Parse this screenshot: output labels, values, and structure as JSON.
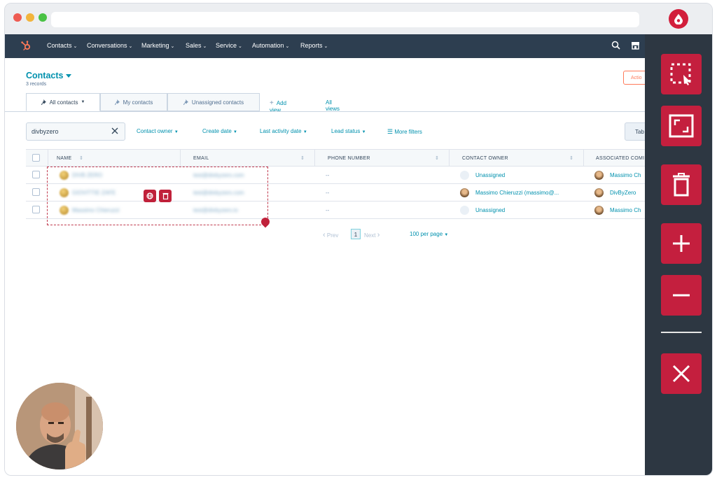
{
  "browser": {
    "extension_icon": "drop-icon"
  },
  "nav": {
    "items": [
      "Contacts",
      "Conversations",
      "Marketing",
      "Sales",
      "Service",
      "Automation",
      "Reports"
    ],
    "caret": "⌄"
  },
  "header": {
    "title": "Contacts",
    "records": "3 records",
    "actions_label": "Actio"
  },
  "tabs": {
    "items": [
      "All contacts",
      "My contacts",
      "Unassigned contacts"
    ],
    "add_view": "Add view",
    "all_views": "All views"
  },
  "filters": {
    "search_value": "divbyzero",
    "items": [
      "Contact owner",
      "Create date",
      "Last activity date",
      "Lead status"
    ],
    "more_filters": "More filters",
    "table_btn": "Tab"
  },
  "table": {
    "columns": [
      "NAME",
      "EMAIL",
      "PHONE NUMBER",
      "CONTACT OWNER",
      "ASSOCIATED COMI"
    ],
    "rows": [
      {
        "name": "DIVB ZERO",
        "email": "test@divbyzero.com",
        "phone": "--",
        "owner": "Unassigned",
        "company": "Massimo Ch"
      },
      {
        "name": "GIOVITTIE ZAFE",
        "email": "test@divbyzero.com",
        "phone": "--",
        "owner": "Massimo Chieruzzi (massimo@...",
        "company": "DivByZero"
      },
      {
        "name": "Massimo Chieruzzi",
        "email": "test@divbyzero.io",
        "phone": "--",
        "owner": "Unassigned",
        "company": "Massimo Ch"
      }
    ]
  },
  "pager": {
    "prev": "Prev",
    "page": "1",
    "next": "Next",
    "per_page": "100 per page"
  },
  "toolbar": {
    "buttons": [
      "select-area-icon",
      "fullscreen-icon",
      "trash-icon",
      "plus-icon",
      "minus-icon",
      "close-icon"
    ]
  }
}
